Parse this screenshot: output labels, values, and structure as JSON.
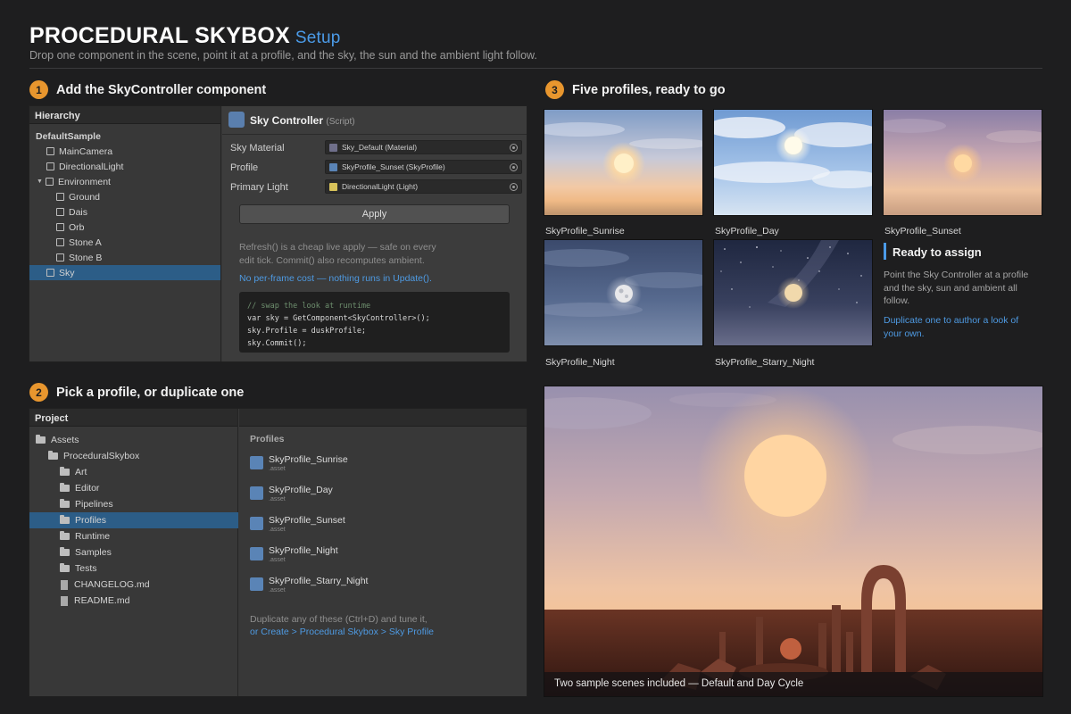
{
  "header": {
    "title": "PROCEDURAL SKYBOX",
    "subtitle": "Setup",
    "tagline": "Drop one component in the scene, point it at a profile, and the sky, the sun and the ambient light follow."
  },
  "steps": [
    {
      "number": "1",
      "title": "Add the SkyController component"
    },
    {
      "number": "2",
      "title": "Pick a profile, or duplicate one"
    },
    {
      "number": "3",
      "title": "Five profiles, ready to go"
    }
  ],
  "hierarchy": {
    "header": "Hierarchy",
    "items": [
      {
        "label": "DefaultSample"
      },
      {
        "label": "MainCamera"
      },
      {
        "label": "DirectionalLight"
      },
      {
        "label": "Environment"
      },
      {
        "label": "Ground"
      },
      {
        "label": "Dais"
      },
      {
        "label": "Orb"
      },
      {
        "label": "Stone A"
      },
      {
        "label": "Stone B"
      },
      {
        "label": "Sky"
      }
    ]
  },
  "inspector": {
    "component": "Sky Controller",
    "component_suffix": "(Script)",
    "properties": [
      {
        "label": "Sky Material",
        "value": "Sky_Default (Material)",
        "color": "#6f6f8a"
      },
      {
        "label": "Profile",
        "value": "SkyProfile_Sunset (SkyProfile)",
        "color": "#5a84b6"
      },
      {
        "label": "Primary Light",
        "value": "DirectionalLight (Light)",
        "color": "#d7c25a"
      }
    ],
    "apply_label": "Apply",
    "note_line1": "Refresh() is a cheap live apply — safe on every",
    "note_line2": "edit tick. Commit() also recomputes ambient.",
    "link": "No per-frame cost — nothing runs in Update().",
    "code": [
      "// swap the look at runtime",
      "var sky = GetComponent<SkyController>();",
      "sky.Profile = duskProfile;",
      "sky.Commit();"
    ]
  },
  "project": {
    "header": "Project",
    "tree": [
      {
        "label": "Assets"
      },
      {
        "label": "ProceduralSkybox"
      },
      {
        "label": "Art"
      },
      {
        "label": "Editor"
      },
      {
        "label": "Pipelines"
      },
      {
        "label": "Profiles"
      },
      {
        "label": "Runtime"
      },
      {
        "label": "Samples"
      },
      {
        "label": "Tests"
      },
      {
        "label": "CHANGELOG.md"
      },
      {
        "label": "README.md"
      }
    ],
    "folder_title": "Profiles",
    "assets": [
      {
        "name": "SkyProfile_Sunrise",
        "ext": ".asset"
      },
      {
        "name": "SkyProfile_Day",
        "ext": ".asset"
      },
      {
        "name": "SkyProfile_Sunset",
        "ext": ".asset"
      },
      {
        "name": "SkyProfile_Night",
        "ext": ".asset"
      },
      {
        "name": "SkyProfile_Starry_Night",
        "ext": ".asset"
      }
    ],
    "hint": "Duplicate any of these (Ctrl+D) and tune it,",
    "hint_link": "or Create > Procedural Skybox > Sky Profile"
  },
  "profiles": [
    {
      "caption": "SkyProfile_Sunrise"
    },
    {
      "caption": "SkyProfile_Day"
    },
    {
      "caption": "SkyProfile_Sunset"
    },
    {
      "caption": "SkyProfile_Night"
    },
    {
      "caption": "SkyProfile_Starry_Night"
    }
  ],
  "ready": {
    "title": "Ready to assign",
    "text": "Point the Sky Controller at a profile and the sky, sun and ambient all follow.",
    "link": "Duplicate one to author a look of your own."
  },
  "hero": {
    "caption": "Two sample scenes included — Default and Day Cycle"
  },
  "colors": {
    "accent": "#4b9be8",
    "badge": "#e8962e",
    "selection": "#2c5d87"
  }
}
